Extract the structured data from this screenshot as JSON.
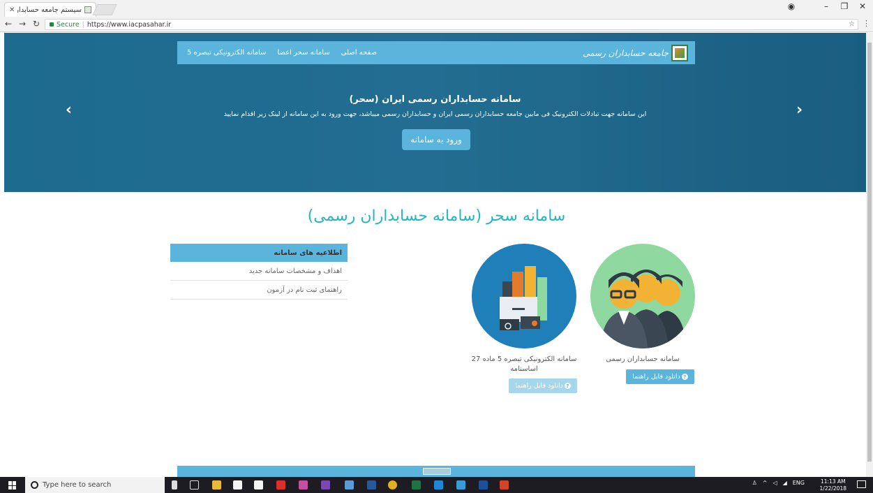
{
  "browser": {
    "tab_title": "سیستم جامعه حسابداران ...",
    "address_secure": "Secure",
    "address_url": "https://www.iacpasahar.ir"
  },
  "nav": {
    "links": [
      "صفحه اصلی",
      "سامانه سحر اعضا",
      "سامانه الکترونیکی تبصره 5"
    ],
    "logo_text": "جامعه حسابداران رسمی"
  },
  "hero": {
    "title": "سامانه حسابداران رسمی ایران (سحر)",
    "subtitle": "این سامانه جهت تبادلات الکترونیک فی مابین جامعه حسابداران رسمی ایران و حسابداران رسمی میباشد، جهت ورود به این سامانه از لینک زیر اقدام نمایید",
    "button": "ورود به سامانه",
    "prev": "‹",
    "next": "›"
  },
  "main": {
    "title": "سامانه سحر (سامانه حسابداران رسمی)"
  },
  "info": {
    "header": "اطلاعیه های سامانه",
    "items": [
      "اهداف و مشخصات سامانه جدید",
      "راهنمای ثبت نام در آزمون"
    ]
  },
  "cards": [
    {
      "caption": "سامانه حسابداران رسمی",
      "button": "دانلود فایل راهنما",
      "btn_color": "#5ab4dc"
    },
    {
      "caption": "سامانه الکترونیکی تبصره 5 ماده 27 اساسنامه",
      "button": "دانلود فایل راهنما",
      "btn_color": "#a6d6ec"
    }
  ],
  "taskbar": {
    "search_placeholder": "Type here to search",
    "lang": "ENG",
    "time": "11:13 AM",
    "date": "1/22/2018"
  },
  "colors": {
    "accent": "#5ab4dc",
    "title": "#21b7c0",
    "hero": "#1d6b8f"
  }
}
